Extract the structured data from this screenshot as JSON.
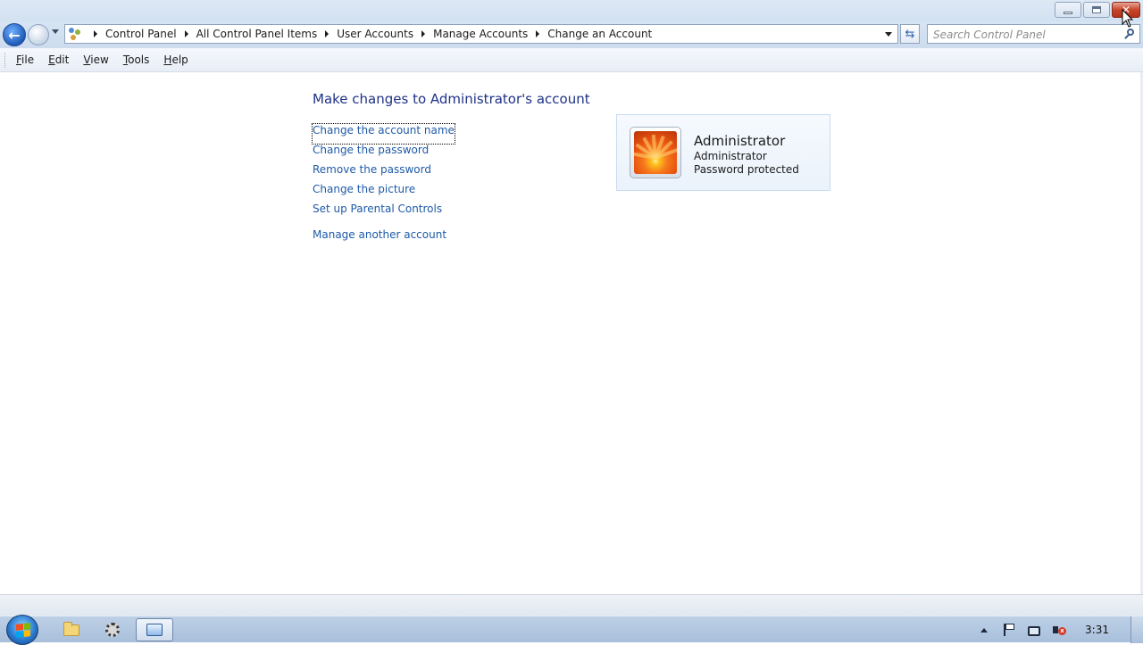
{
  "window": {
    "controls": {
      "minimize": "minimize-icon",
      "maximize": "restore-icon",
      "close": "close-icon"
    }
  },
  "navigation": {
    "back_icon": "back-arrow-icon",
    "forward_icon": "forward-arrow-icon",
    "breadcrumbs": [
      "Control Panel",
      "All Control Panel Items",
      "User Accounts",
      "Manage Accounts",
      "Change an Account"
    ],
    "search_placeholder": "Search Control Panel"
  },
  "menu": {
    "items": [
      {
        "label": "File",
        "accel": "F"
      },
      {
        "label": "Edit",
        "accel": "E"
      },
      {
        "label": "View",
        "accel": "V"
      },
      {
        "label": "Tools",
        "accel": "T"
      },
      {
        "label": "Help",
        "accel": "H"
      }
    ]
  },
  "content": {
    "heading": "Make changes to Administrator's account",
    "tasks": [
      "Change the account name",
      "Change the password",
      "Remove the password",
      "Change the picture",
      "Set up Parental Controls"
    ],
    "manage_another": "Manage another account"
  },
  "account": {
    "name": "Administrator",
    "type": "Administrator",
    "status": "Password protected"
  },
  "taskbar": {
    "pinned": [
      "windows-explorer-icon",
      "settings-gear-icon",
      "control-panel-icon"
    ],
    "clock": "3:31"
  },
  "colors": {
    "link": "#1e5aa8",
    "heading": "#1e3287",
    "close_button": "#c7462b"
  }
}
